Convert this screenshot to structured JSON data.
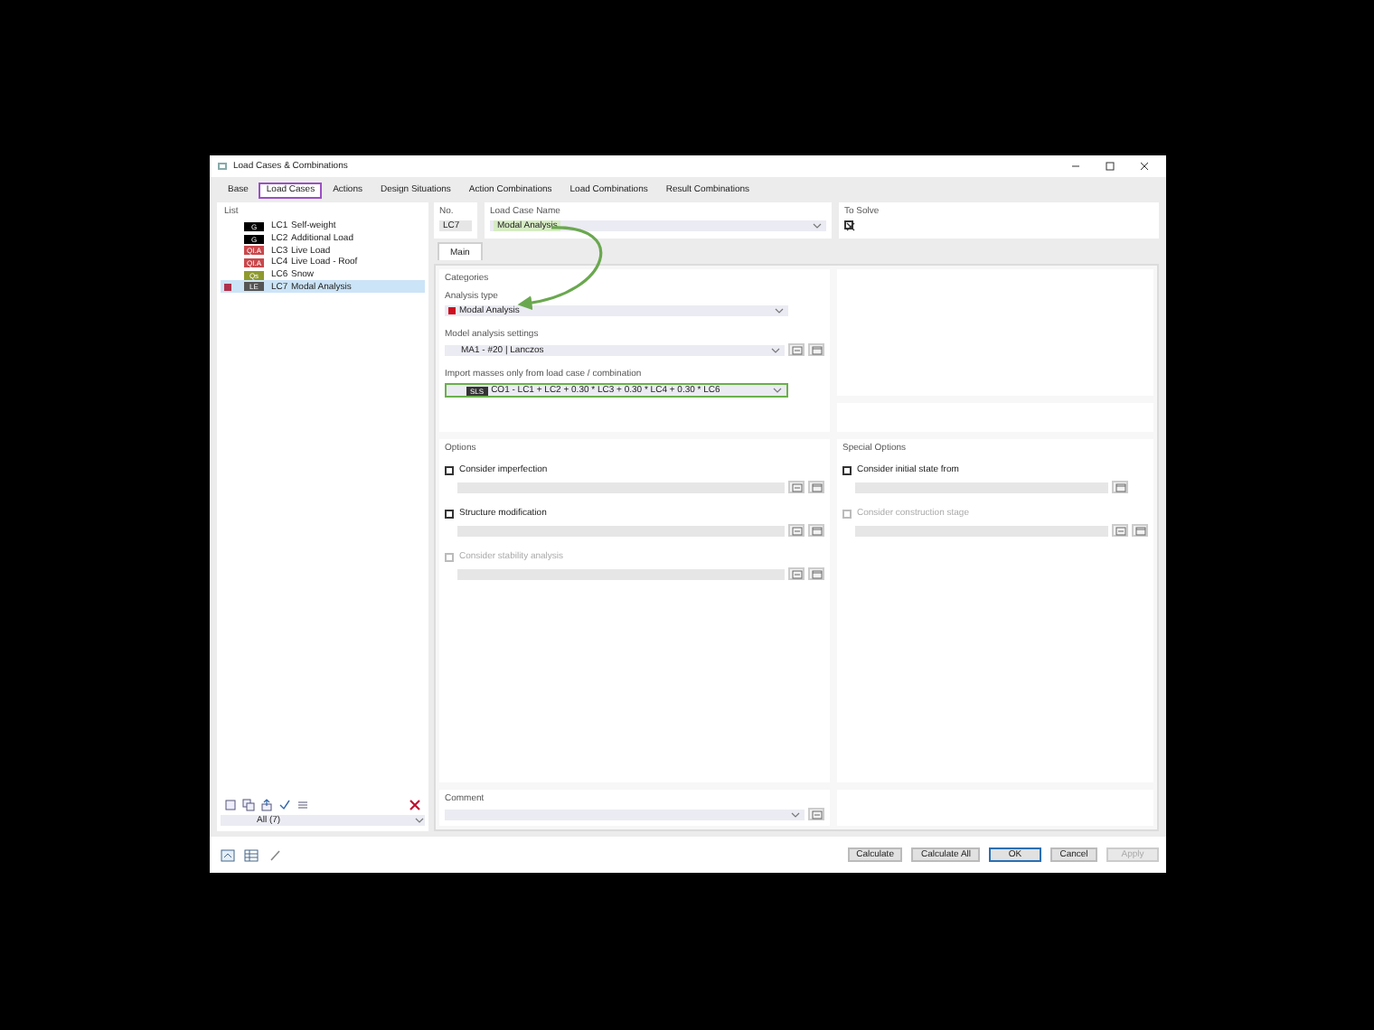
{
  "window": {
    "title": "Load Cases & Combinations"
  },
  "tabs": [
    {
      "label": "Base",
      "selected": false
    },
    {
      "label": "Load Cases",
      "selected": true
    },
    {
      "label": "Actions",
      "selected": false
    },
    {
      "label": "Design Situations",
      "selected": false
    },
    {
      "label": "Action Combinations",
      "selected": false
    },
    {
      "label": "Load Combinations",
      "selected": false
    },
    {
      "label": "Result Combinations",
      "selected": false
    }
  ],
  "list": {
    "header": "List",
    "items": [
      {
        "tag": "G",
        "color": "#000000",
        "number": "LC1",
        "name": "Self-weight",
        "flagged": false,
        "selected": false
      },
      {
        "tag": "G",
        "color": "#000000",
        "number": "LC2",
        "name": "Additional Load",
        "flagged": false,
        "selected": false
      },
      {
        "tag": "QI.A",
        "color": "#c9484c",
        "number": "LC3",
        "name": "Live Load",
        "flagged": false,
        "selected": false
      },
      {
        "tag": "QI.A",
        "color": "#c9484c",
        "number": "LC4",
        "name": "Live Load - Roof",
        "flagged": false,
        "selected": false
      },
      {
        "tag": "Qs",
        "color": "#8f9a2e",
        "number": "LC6",
        "name": "Snow",
        "flagged": false,
        "selected": false
      },
      {
        "tag": "LE",
        "color": "#555555",
        "number": "LC7",
        "name": "Modal Analysis",
        "flagged": true,
        "selected": true
      }
    ],
    "filter": "All (7)"
  },
  "general": {
    "no_label": "No.",
    "no": "LC7",
    "name_label": "Load Case Name",
    "name": "Modal Analysis",
    "name_highlighted": true,
    "to_solve_label": "To Solve",
    "to_solve": true
  },
  "main_tabs": [
    {
      "label": "Main",
      "selected": true
    }
  ],
  "categories": {
    "title": "Categories",
    "analysis_type_label": "Analysis type",
    "analysis_type": {
      "value": "Modal Analysis",
      "color": "#cc1020"
    },
    "modal_settings_label": "Model analysis settings",
    "modal_settings": "MA1 - #20 | Lanczos",
    "import_label": "Import masses only from load case / combination",
    "import_tag": "SLS",
    "import_value": "CO1 - LC1 + LC2 + 0.30 * LC3 + 0.30 * LC4 + 0.30 * LC6",
    "import_highlighted": true
  },
  "callout_arrow": true,
  "options": {
    "title": "Options",
    "items": [
      {
        "label": "Consider imperfection",
        "checked": false,
        "disabled": false,
        "kind": "double"
      },
      {
        "label": "Structure modification",
        "checked": false,
        "disabled": false,
        "kind": "double"
      },
      {
        "label": "Consider stability analysis",
        "checked": false,
        "disabled": true,
        "kind": "double"
      }
    ]
  },
  "special_options": {
    "title": "Special Options",
    "items": [
      {
        "label": "Consider initial state from",
        "checked": false,
        "disabled": false,
        "kind": "single"
      },
      {
        "label": "Consider construction stage",
        "checked": false,
        "disabled": true,
        "kind": "double"
      }
    ]
  },
  "comment": {
    "label": "Comment"
  },
  "buttons": [
    {
      "label": "Calculate",
      "kind": "plain"
    },
    {
      "label": "Calculate All",
      "kind": "plain"
    },
    {
      "label": "OK",
      "kind": "default"
    },
    {
      "label": "Cancel",
      "kind": "plain"
    },
    {
      "label": "Apply",
      "kind": "disabled"
    }
  ]
}
